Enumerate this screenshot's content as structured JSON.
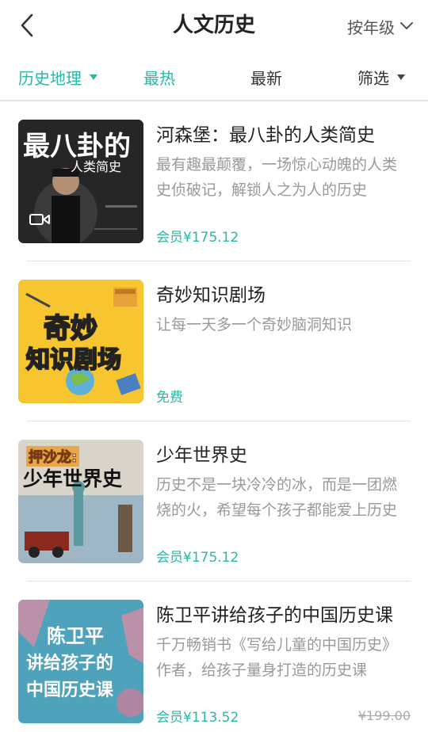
{
  "header": {
    "title": "人文历史",
    "grade_label": "按年级"
  },
  "tabs": [
    {
      "label": "历史地理",
      "active": true,
      "dropdown": true
    },
    {
      "label": "最热",
      "active": true,
      "dropdown": false
    },
    {
      "label": "最新",
      "active": false,
      "dropdown": false
    },
    {
      "label": "筛选",
      "active": false,
      "dropdown": true
    }
  ],
  "colors": {
    "accent": "#2ab8a4"
  },
  "items": [
    {
      "title": "河森堡：最八卦的人类简史",
      "desc": "最有趣最颠覆，一场惊心动魄的人类史侦破记，解锁人之为人的历史",
      "price": "会员¥175.12",
      "original_price": "",
      "cover_text_1": "最八卦的",
      "cover_text_2": "人类简史",
      "cover_icon": "video-camera-icon"
    },
    {
      "title": "奇妙知识剧场",
      "desc": "让每一天多一个奇妙脑洞知识",
      "price": "免费",
      "original_price": "",
      "cover_text_1": "奇妙",
      "cover_text_2": "知识剧场"
    },
    {
      "title": "少年世界史",
      "desc": "历史不是一块冷冷的冰，而是一团燃烧的火，希望每个孩子都能爱上历史",
      "price": "会员¥175.12",
      "original_price": "",
      "cover_text_1": "押沙龙:",
      "cover_text_2": "少年世界史"
    },
    {
      "title": "陈卫平讲给孩子的中国历史课",
      "desc": "千万畅销书《写给儿童的中国历史》作者，给孩子量身打造的历史课",
      "price": "会员¥113.52",
      "original_price": "¥199.00",
      "cover_text_1": "陈卫平",
      "cover_text_2": "讲给孩子的",
      "cover_text_3": "中国历史课"
    }
  ]
}
